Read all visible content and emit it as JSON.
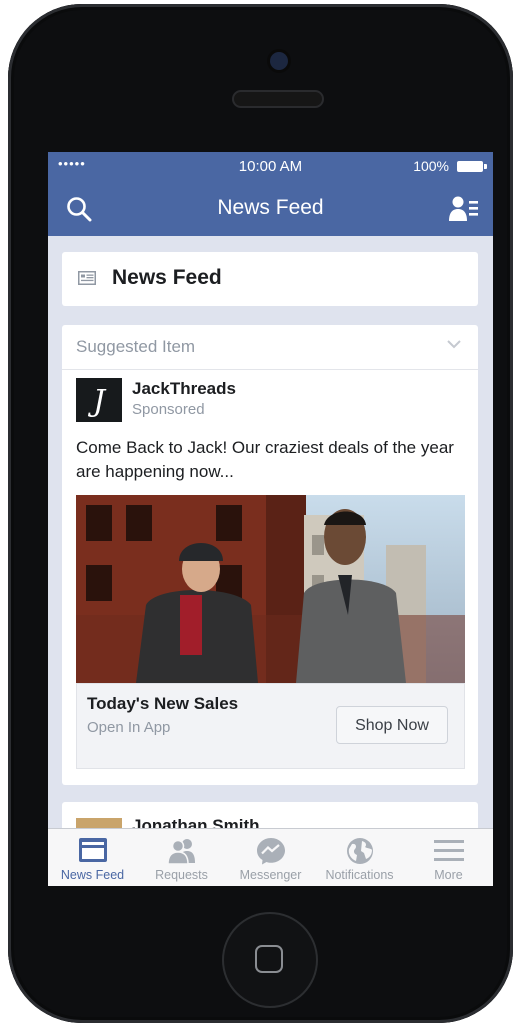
{
  "status_bar": {
    "signal": "•••••",
    "time": "10:00 AM",
    "battery": "100%"
  },
  "nav": {
    "title": "News Feed",
    "icons": [
      "search-icon",
      "friend-requests-icon"
    ]
  },
  "feed_header": {
    "title": "News Feed",
    "icon": "news-feed-icon"
  },
  "post": {
    "label": "Suggested Item",
    "page_name": "JackThreads",
    "avatar_letter": "J",
    "sponsored": "Sponsored",
    "text": "Come Back to Jack! Our craziest deals of the year are happening now...",
    "ad_title": "Today's New Sales",
    "ad_subtitle": "Open In App",
    "cta": "Shop Now"
  },
  "next_post": {
    "name": "Jonathan Smith"
  },
  "tabs": [
    {
      "label": "News Feed",
      "icon": "news-feed-icon",
      "active": true
    },
    {
      "label": "Requests",
      "icon": "requests-icon",
      "active": false
    },
    {
      "label": "Messenger",
      "icon": "messenger-icon",
      "active": false
    },
    {
      "label": "Notifications",
      "icon": "globe-icon",
      "active": false
    },
    {
      "label": "More",
      "icon": "menu-icon",
      "active": false
    }
  ],
  "colors": {
    "brand": "#4a67a3",
    "background": "#dfe3ee",
    "inactive_tab": "#9aa0a8"
  }
}
